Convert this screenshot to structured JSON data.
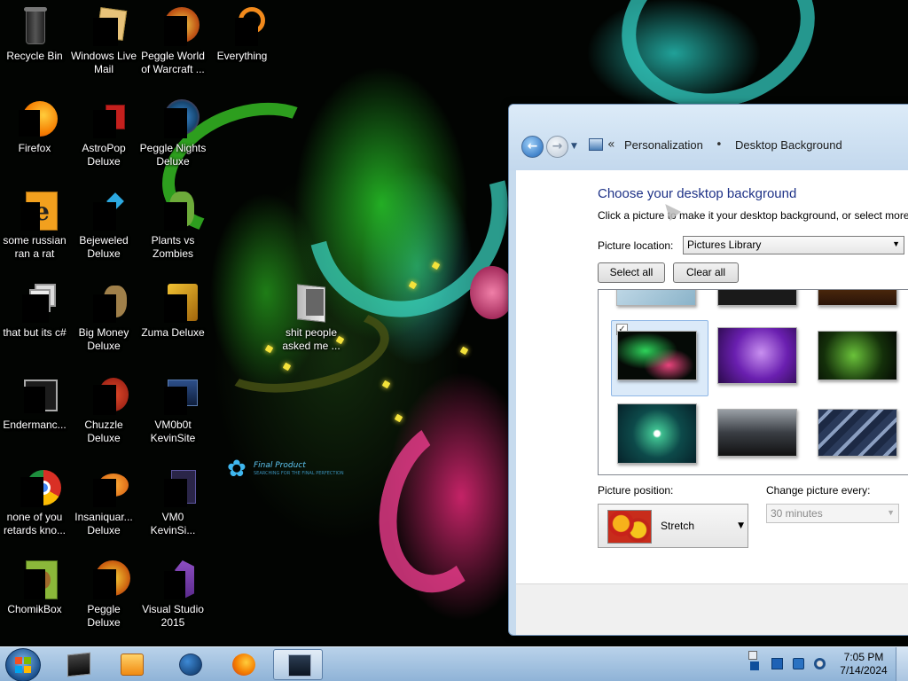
{
  "desktop": {
    "icons": [
      {
        "label": "Recycle Bin",
        "icon": "recycle-bin-icon"
      },
      {
        "label": "Windows Live Mail",
        "icon": "windows-live-mail-icon"
      },
      {
        "label": "Peggle World of Warcraft ...",
        "icon": "peggle-world-of-warcraft-icon"
      },
      {
        "label": "Everything",
        "icon": "everything-search-icon"
      },
      {
        "label": "Firefox",
        "icon": "firefox-icon"
      },
      {
        "label": "AstroPop Deluxe",
        "icon": "astropop-deluxe-icon"
      },
      {
        "label": "Peggle Nights Deluxe",
        "icon": "peggle-nights-deluxe-icon"
      },
      {
        "label": "some russian ran a rat",
        "icon": "file-e-icon"
      },
      {
        "label": "Bejeweled Deluxe",
        "icon": "bejeweled-deluxe-icon"
      },
      {
        "label": "Plants vs Zombies",
        "icon": "plants-vs-zombies-icon"
      },
      {
        "label": "that but its c#",
        "icon": "stacked-windows-icon"
      },
      {
        "label": "Big Money Deluxe",
        "icon": "big-money-deluxe-icon"
      },
      {
        "label": "Zuma Deluxe",
        "icon": "zuma-deluxe-icon"
      },
      {
        "label": "shit people asked me ...",
        "icon": "folder-icon"
      },
      {
        "label": "Endermanc...",
        "icon": "endermanch-icon"
      },
      {
        "label": "Chuzzle Deluxe",
        "icon": "chuzzle-deluxe-icon"
      },
      {
        "label": "VM0b0t KevinSite",
        "icon": "vm-folder-icon"
      },
      {
        "label": "none of you retards kno...",
        "icon": "chrome-icon"
      },
      {
        "label": "Insaniquar... Deluxe",
        "icon": "insaniquarium-deluxe-icon"
      },
      {
        "label": "VM0 KevinSi...",
        "icon": "document-icon"
      },
      {
        "label": "ChomikBox",
        "icon": "chomikbox-icon"
      },
      {
        "label": "Peggle Deluxe",
        "icon": "peggle-deluxe-icon"
      },
      {
        "label": "Visual Studio 2015",
        "icon": "visual-studio-icon"
      }
    ],
    "wallpaper_logo": {
      "title": "Final Product",
      "tagline": "SEARCHING FOR THE FINAL PERFECTION"
    }
  },
  "window": {
    "breadcrumb": [
      "Personalization",
      "Desktop Background"
    ],
    "heading": "Choose your desktop background",
    "description": "Click a picture to make it your desktop background, or select more",
    "picture_location_label": "Picture location:",
    "picture_location_value": "Pictures Library",
    "select_all": "Select all",
    "clear_all": "Clear all",
    "picture_position_label": "Picture position:",
    "picture_position_value": "Stretch",
    "change_every_label": "Change picture every:",
    "change_every_value": "30 minutes"
  },
  "taskbar": {
    "time": "7:05 PM",
    "date": "7/14/2024"
  },
  "colors": {
    "heading": "#1e3287",
    "taskbar": "#a3c2e2",
    "wallpaper_green": "#28c828",
    "wallpaper_pink": "#e62878"
  }
}
